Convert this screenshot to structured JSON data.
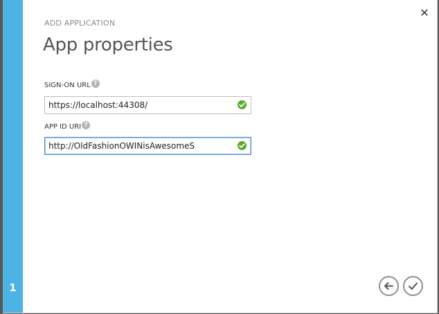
{
  "wizard": {
    "step_number": "1",
    "overline": "ADD APPLICATION",
    "title": "App properties",
    "close_glyph": "✕"
  },
  "fields": {
    "sign_on_url": {
      "label": "SIGN-ON URL",
      "help": "?",
      "value": "https://localhost:44308/",
      "status": "valid"
    },
    "app_id_uri": {
      "label": "APP ID URI",
      "help": "?",
      "value": "http://OldFashionOWINisAwesomeS",
      "status": "valid"
    }
  },
  "navigation": {
    "back_icon": "arrow-left-icon",
    "finish_icon": "checkmark-icon"
  },
  "colors": {
    "accent": "#4db3e4",
    "valid": "#5aab2f"
  }
}
